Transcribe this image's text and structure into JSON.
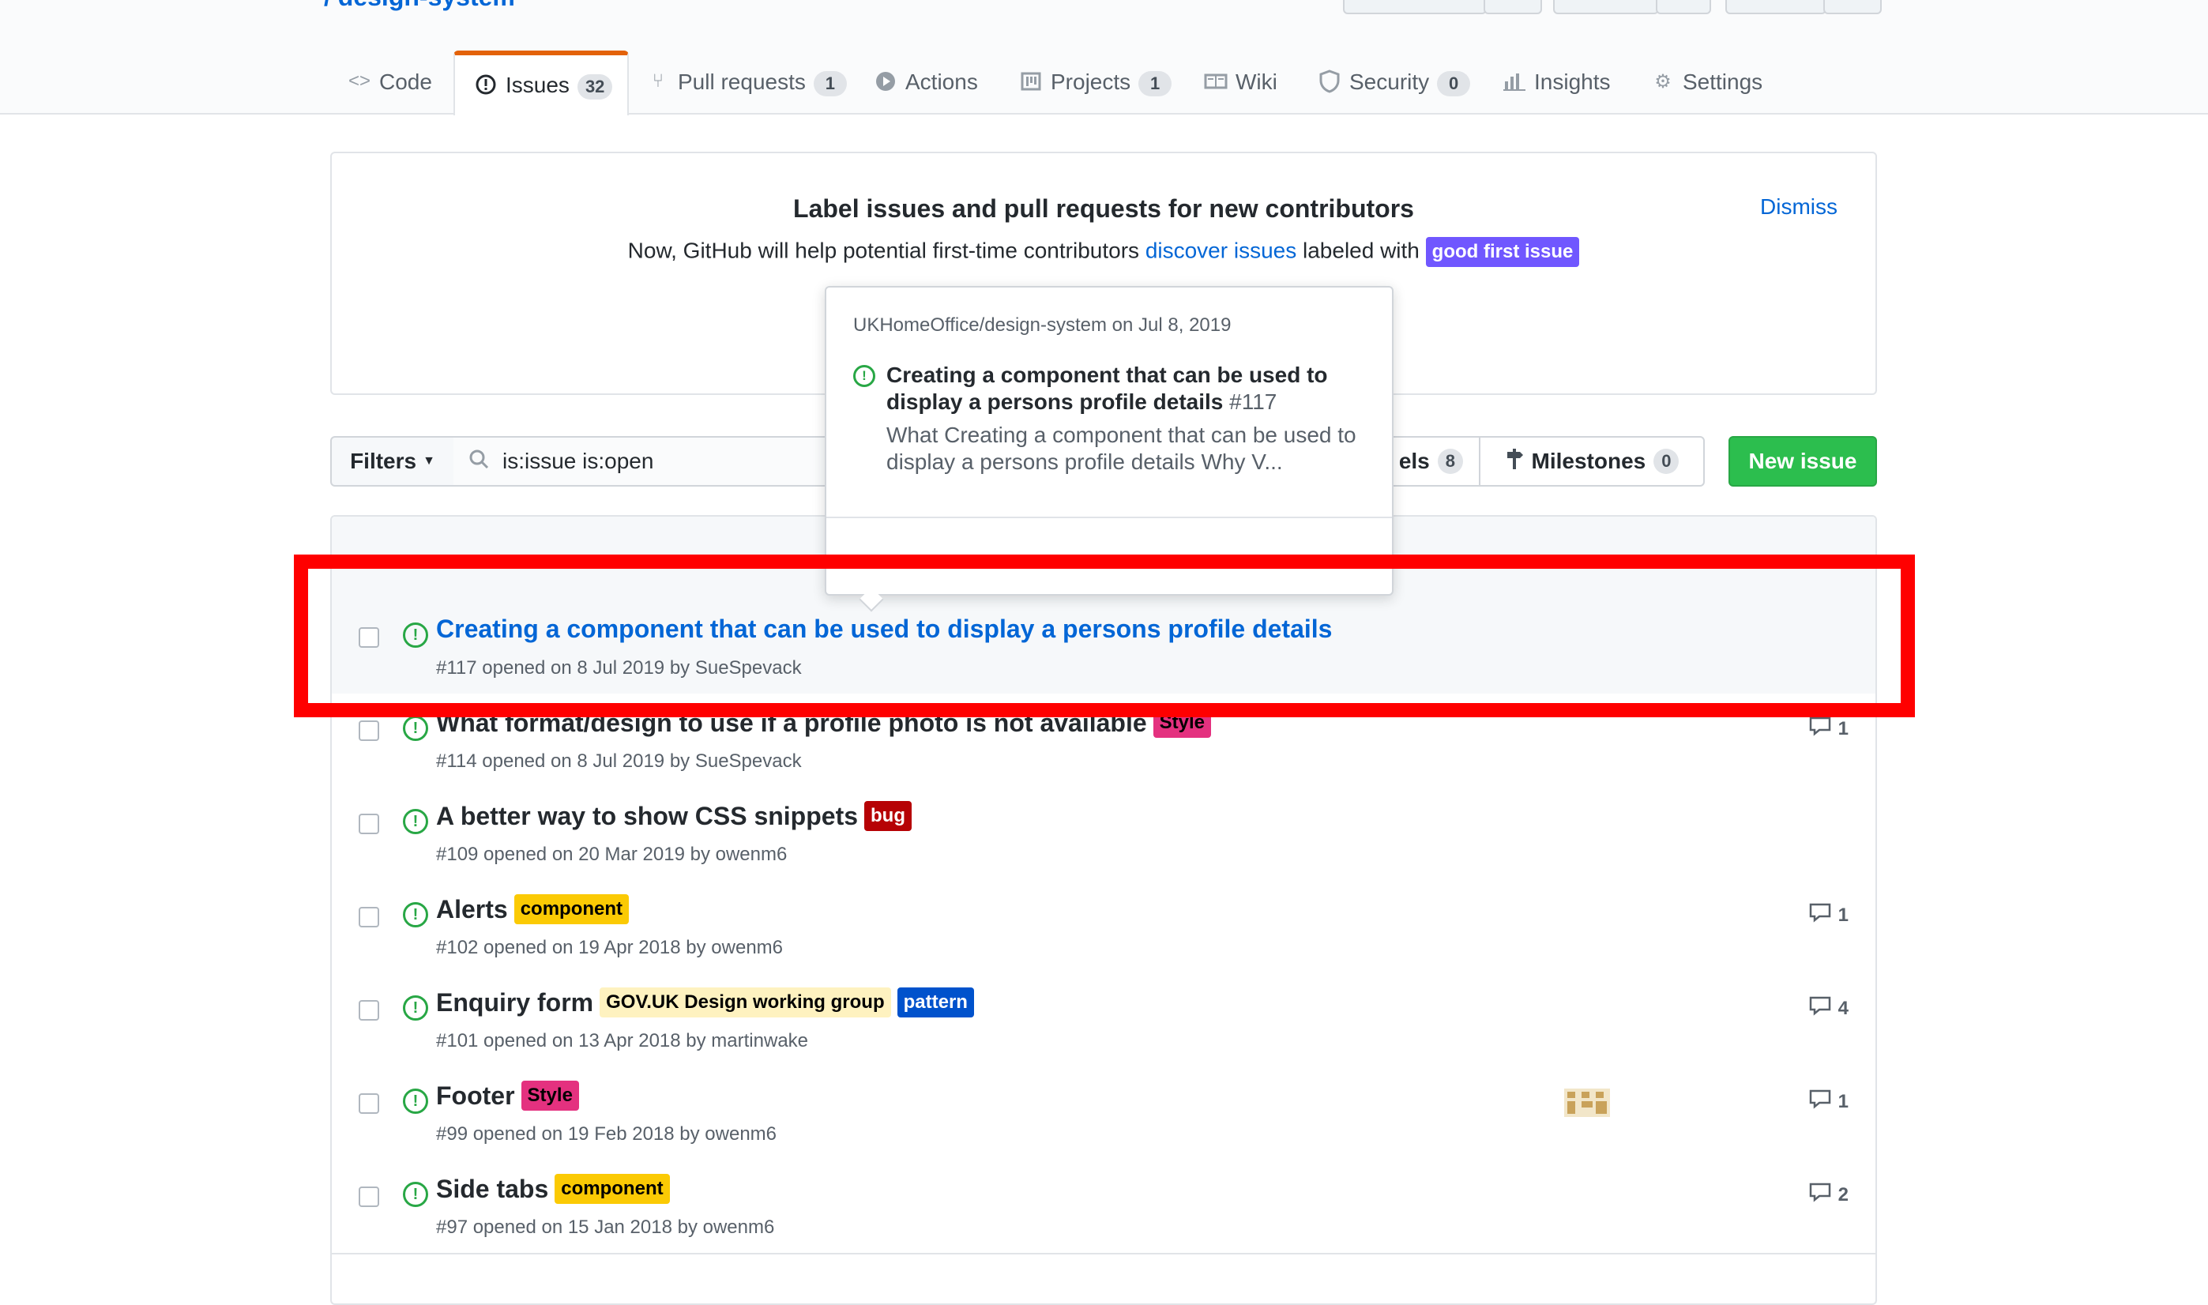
{
  "colors": {
    "link": "#0366d6",
    "open_green": "#28a745",
    "new_issue_bg": "#2cbe4e",
    "selected_tab_accent": "#e36209",
    "annotation_red": "#ff0000"
  },
  "repo": {
    "visible_fragment": "/ design-system"
  },
  "tabs": [
    {
      "label": "Code",
      "icon": "code-icon",
      "count": ""
    },
    {
      "label": "Issues",
      "icon": "issue-opened-icon",
      "count": "32"
    },
    {
      "label": "Pull requests",
      "icon": "git-pull-request-icon",
      "count": "1"
    },
    {
      "label": "Actions",
      "icon": "play-icon",
      "count": ""
    },
    {
      "label": "Projects",
      "icon": "project-icon",
      "count": "1"
    },
    {
      "label": "Wiki",
      "icon": "book-icon",
      "count": ""
    },
    {
      "label": "Security",
      "icon": "shield-icon",
      "count": "0"
    },
    {
      "label": "Insights",
      "icon": "graph-icon",
      "count": ""
    },
    {
      "label": "Settings",
      "icon": "gear-icon",
      "count": ""
    }
  ],
  "banner": {
    "title": "Label issues and pull requests for new contributors",
    "desc_before": "Now, GitHub will help potential first-time contributors",
    "desc_link": "discover issues",
    "desc_after": "labeled with",
    "label": "good first issue",
    "dismiss": "Dismiss"
  },
  "toolbar": {
    "filters": "Filters",
    "search_value": "is:issue is:open",
    "labels_fragment": "els",
    "labels_count": "8",
    "milestones": "Milestones",
    "milestones_count": "0",
    "new_issue": "New issue"
  },
  "popover": {
    "repo_line": "UKHomeOffice/design-system on Jul 8, 2019",
    "title": "Creating a component that can be used to display a persons profile details",
    "number": "#117",
    "body": "What Creating a component that can be used to display a persons profile details Why V..."
  },
  "issues": [
    {
      "title": "Creating a component that can be used to display a persons profile details",
      "meta": "#117 opened on 8 Jul 2019 by SueSpevack",
      "labels": [],
      "comments": ""
    },
    {
      "title": "What format/design to use if a profile photo is not available",
      "meta": "#114 opened on 8 Jul 2019 by SueSpevack",
      "labels": [
        {
          "text": "Style",
          "bg": "#e4317f",
          "fg": "#000000"
        }
      ],
      "comments": "1"
    },
    {
      "title": "A better way to show CSS snippets",
      "meta": "#109 opened on 20 Mar 2019 by owenm6",
      "labels": [
        {
          "text": "bug",
          "bg": "#b60205",
          "fg": "#ffffff"
        }
      ],
      "comments": ""
    },
    {
      "title": "Alerts",
      "meta": "#102 opened on 19 Apr 2018 by owenm6",
      "labels": [
        {
          "text": "component",
          "bg": "#fbca04",
          "fg": "#000000"
        }
      ],
      "comments": "1"
    },
    {
      "title": "Enquiry form",
      "meta": "#101 opened on 13 Apr 2018 by martinwake",
      "labels": [
        {
          "text": "GOV.UK Design working group",
          "bg": "#fef2c0",
          "fg": "#000000"
        },
        {
          "text": "pattern",
          "bg": "#0052cc",
          "fg": "#ffffff"
        }
      ],
      "comments": "4"
    },
    {
      "title": "Footer",
      "meta": "#99 opened on 19 Feb 2018 by owenm6",
      "labels": [
        {
          "text": "Style",
          "bg": "#e4317f",
          "fg": "#000000"
        }
      ],
      "comments": "1"
    },
    {
      "title": "Side tabs",
      "meta": "#97 opened on 15 Jan 2018 by owenm6",
      "labels": [
        {
          "text": "component",
          "bg": "#fbca04",
          "fg": "#000000"
        }
      ],
      "comments": "2"
    }
  ]
}
